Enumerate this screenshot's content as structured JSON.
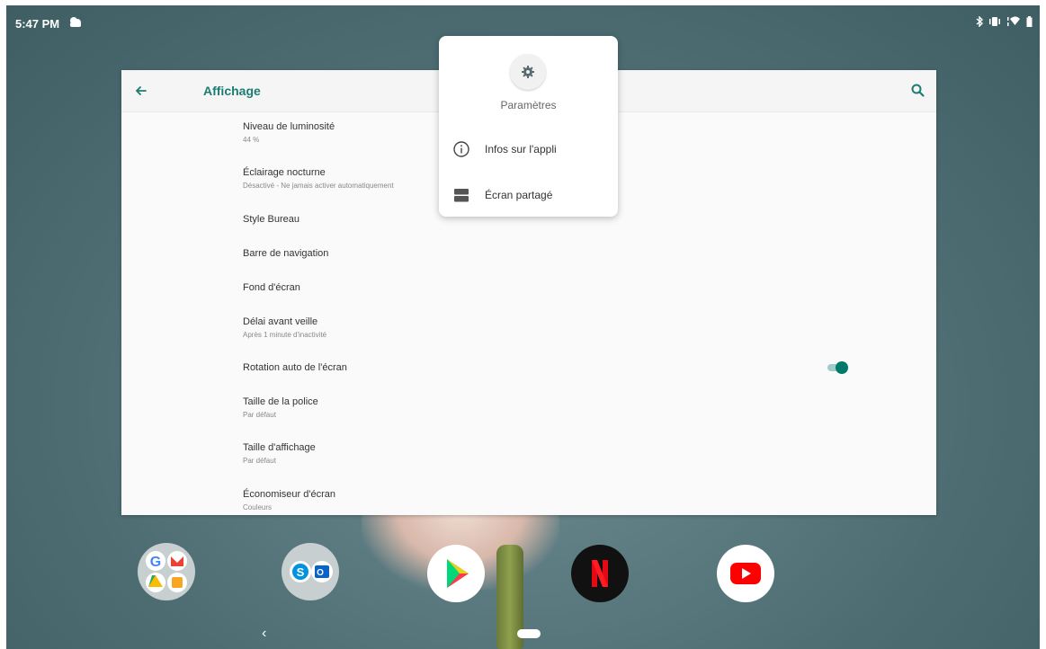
{
  "status_bar": {
    "time": "5:47 PM",
    "icons": [
      "bluetooth-icon",
      "vibrate-icon",
      "wifi-icon",
      "battery-icon"
    ]
  },
  "settings_window": {
    "title": "Affichage",
    "back_icon": "arrow-left-icon",
    "search_icon": "search-icon",
    "accent_color": "#1c7c73",
    "items": [
      {
        "title": "Niveau de luminosité",
        "summary": "44 %"
      },
      {
        "title": "Éclairage nocturne",
        "summary": "Désactivé - Ne jamais activer automatiquement"
      },
      {
        "title": "Style Bureau",
        "summary": ""
      },
      {
        "title": "Barre de navigation",
        "summary": ""
      },
      {
        "title": "Fond d'écran",
        "summary": ""
      },
      {
        "title": "Délai avant veille",
        "summary": "Après 1 minute d'inactivité"
      },
      {
        "title": "Rotation auto de l'écran",
        "summary": "",
        "toggle": true
      },
      {
        "title": "Taille de la police",
        "summary": "Par défaut"
      },
      {
        "title": "Taille d'affichage",
        "summary": "Par défaut"
      },
      {
        "title": "Économiseur d'écran",
        "summary": "Couleurs"
      }
    ]
  },
  "popup": {
    "app_name": "Paramètres",
    "app_icon": "gear-icon",
    "items": [
      {
        "label": "Infos sur l'appli",
        "icon": "info-icon"
      },
      {
        "label": "Écran partagé",
        "icon": "split-screen-icon"
      }
    ]
  },
  "dock": {
    "apps": [
      {
        "name": "google-folder",
        "icon": "google-apps-folder-icon"
      },
      {
        "name": "microsoft-folder",
        "icon": "skype-outlook-folder-icon"
      },
      {
        "name": "play-store",
        "icon": "play-store-icon"
      },
      {
        "name": "netflix",
        "icon": "netflix-icon"
      },
      {
        "name": "youtube",
        "icon": "youtube-icon"
      }
    ]
  },
  "nav_bar": {
    "back_glyph": "‹"
  }
}
